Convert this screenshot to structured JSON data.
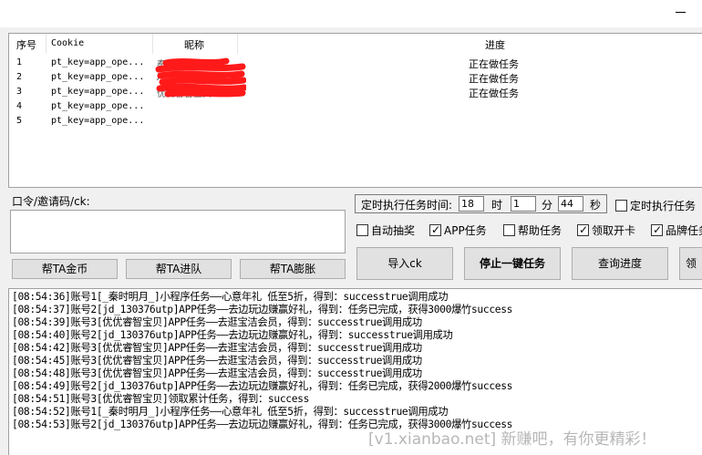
{
  "window": {
    "minimize_icon": "minimize-icon"
  },
  "account_list": {
    "headers": {
      "seq": "序号",
      "cookie": "Cookie",
      "nickname": "昵称",
      "progress": "进度"
    },
    "rows": [
      {
        "seq": "1",
        "cookie": "pt_key=app_ope...",
        "nickname": "秦时明月",
        "progress": "正在做任务"
      },
      {
        "seq": "2",
        "cookie": "pt_key=app_ope...",
        "nickname": "jd_130376utp",
        "progress": "正在做任务"
      },
      {
        "seq": "3",
        "cookie": "pt_key=app_ope...",
        "nickname": "优优睿智宝贝",
        "progress": "正在做任务"
      },
      {
        "seq": "4",
        "cookie": "pt_key=app_ope...",
        "nickname": "",
        "progress": ""
      },
      {
        "seq": "5",
        "cookie": "pt_key=app_ope...",
        "nickname": "",
        "progress": ""
      }
    ],
    "redaction_color": "#ff1a1a"
  },
  "code_label": "口令/邀请码/ck:",
  "help_buttons": {
    "coin": "帮TA金币",
    "queue": "帮TA进队",
    "expand": "帮TA膨胀"
  },
  "timer": {
    "label": "定时执行任务时间:",
    "hour": "18",
    "hour_unit": "时",
    "minute": "1",
    "minute_unit": "分",
    "second": "44",
    "second_unit": "秒",
    "enable_label": "定时执行任务",
    "enable_checked": false
  },
  "options": [
    {
      "label": "自动抽奖",
      "checked": false
    },
    {
      "label": "APP任务",
      "checked": true
    },
    {
      "label": "帮助任务",
      "checked": false
    },
    {
      "label": "领取开卡",
      "checked": true
    },
    {
      "label": "品牌任务",
      "checked": true
    }
  ],
  "actions": {
    "import": "导入ck",
    "stop": "停止一键任务",
    "query": "查询进度",
    "more": "领"
  },
  "log": [
    "[08:54:36]账号1[_秦时明月_]小程序任务——心意年礼 低至5折，得到：successtrue调用成功",
    "[08:54:37]账号2[jd_130376utp]APP任务——去边玩边赚赢好礼，得到：任务已完成，获得3000爆竹success",
    "[08:54:39]账号3[优优睿智宝贝]APP任务——去逛宝洁会员，得到：successtrue调用成功",
    "[08:54:40]账号2[jd_130376utp]APP任务——去边玩边赚赢好礼，得到：successtrue调用成功",
    "[08:54:42]账号3[优优睿智宝贝]APP任务——去逛宝洁会员，得到：successtrue调用成功",
    "[08:54:45]账号3[优优睿智宝贝]APP任务——去逛宝洁会员，得到：successtrue调用成功",
    "[08:54:48]账号3[优优睿智宝贝]APP任务——去逛宝洁会员，得到：successtrue调用成功",
    "[08:54:49]账号2[jd_130376utp]APP任务——去边玩边赚赢好礼，得到：任务已完成，获得2000爆竹success",
    "[08:54:51]账号3[优优睿智宝贝]领取累计任务，得到：success",
    "[08:54:52]账号1[_秦时明月_]小程序任务——心意年礼 低至5折，得到：successtrue调用成功",
    "[08:54:53]账号2[jd_130376utp]APP任务——去边玩边赚赢好礼，得到：任务已完成，获得3000爆竹success"
  ],
  "watermark": "[v1.xianbao.net] 新赚吧，有你更精彩！"
}
